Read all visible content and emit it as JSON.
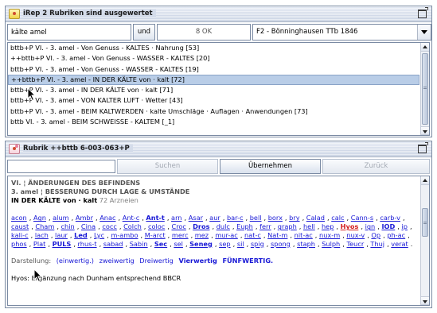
{
  "frame1": {
    "title": "iRep 2 Rubriken sind ausgewertet",
    "search": {
      "value": "kälte amel"
    },
    "und_label": "und",
    "ok_label": "8 OK",
    "source_select": "F2 - Bönninghausen  TTb 1846",
    "rubrics": [
      "bttb+P  VI. - 3. amel - Von Genuss - KALTES · Nahrung  [53]",
      "++bttb+P  VI. - 3. amel - Von Genuss - WASSER - KALTES [20]",
      "bttb+P  VI. - 3. amel - Von Genuss - WASSER - KALTES  [19]",
      "++bttb+P  VI. - 3. amel - IN DER KÄLTE von · kalt [72]",
      "bttb+P  VI. - 3. amel - IN DER KÄLTE von · kalt [71]",
      "bttb+P  VI. - 3. amel - VON KALTER LUFT · Wetter  [43]",
      "bttb+P  VI. - 3. amel - BEIM KALTWERDEN · kalte Umschläge · Auflagen · Anwendungen  [73]",
      "bttb  VI. - 3. amel - BEIM SCHWEISSE - KALTEM  [_1]"
    ],
    "selected_index": 3
  },
  "frame2": {
    "title": "Rubrik  ++bttb 6-003-063+P",
    "search_button": "Suchen",
    "accept_button": "Übernehmen",
    "back_button": "Zurück",
    "header_line1": "VI. ¦ ÄNDERUNGEN DES BEFINDENS",
    "header_line2": "3. amel ¦ BESSERUNG DURCH LAGE & UMSTÄNDE",
    "header_line3": "IN DER KÄLTE von · kalt",
    "remedy_count": "72 Arzneien",
    "remedies": [
      {
        "t": "acon",
        "s": ""
      },
      {
        "t": "Agn",
        "s": ""
      },
      {
        "t": "alum",
        "s": ""
      },
      {
        "t": "Ambr",
        "s": ""
      },
      {
        "t": "Anac",
        "s": ""
      },
      {
        "t": "Ant-c",
        "s": ""
      },
      {
        "t": "Ant-t",
        "s": "b"
      },
      {
        "t": "arn",
        "s": ""
      },
      {
        "t": "Asar",
        "s": ""
      },
      {
        "t": "aur",
        "s": ""
      },
      {
        "t": "bar-c",
        "s": ""
      },
      {
        "t": "bell",
        "s": ""
      },
      {
        "t": "borx",
        "s": ""
      },
      {
        "t": "bry",
        "s": ""
      },
      {
        "t": "Calad",
        "s": ""
      },
      {
        "t": "calc",
        "s": ""
      },
      {
        "t": "Cann-s",
        "s": ""
      },
      {
        "t": "carb-v",
        "s": ""
      },
      {
        "t": "caust",
        "s": ""
      },
      {
        "t": "Cham",
        "s": ""
      },
      {
        "t": "chin",
        "s": ""
      },
      {
        "t": "Cina",
        "s": ""
      },
      {
        "t": "cocc",
        "s": ""
      },
      {
        "t": "Colch",
        "s": ""
      },
      {
        "t": "coloc",
        "s": ""
      },
      {
        "t": "Croc",
        "s": ""
      },
      {
        "t": "Dros",
        "s": "b"
      },
      {
        "t": "dulc",
        "s": ""
      },
      {
        "t": "Euph",
        "s": ""
      },
      {
        "t": "ferr",
        "s": ""
      },
      {
        "t": "graph",
        "s": ""
      },
      {
        "t": "hell",
        "s": ""
      },
      {
        "t": "hep",
        "s": ""
      },
      {
        "t": "Hyos",
        "s": "red"
      },
      {
        "t": "ign",
        "s": ""
      },
      {
        "t": "IOD",
        "s": "b"
      },
      {
        "t": "ip",
        "s": ""
      },
      {
        "t": "kali-c",
        "s": ""
      },
      {
        "t": "lach",
        "s": ""
      },
      {
        "t": "laur",
        "s": ""
      },
      {
        "t": "Led",
        "s": "b"
      },
      {
        "t": "Lyc",
        "s": ""
      },
      {
        "t": "m-ambo",
        "s": ""
      },
      {
        "t": "M-arct",
        "s": ""
      },
      {
        "t": "merc",
        "s": ""
      },
      {
        "t": "mez",
        "s": ""
      },
      {
        "t": "mur-ac",
        "s": ""
      },
      {
        "t": "nat-c",
        "s": ""
      },
      {
        "t": "Nat-m",
        "s": ""
      },
      {
        "t": "nit-ac",
        "s": ""
      },
      {
        "t": "nux-m",
        "s": ""
      },
      {
        "t": "nux-v",
        "s": ""
      },
      {
        "t": "Op",
        "s": ""
      },
      {
        "t": "ph-ac",
        "s": ""
      },
      {
        "t": "phos",
        "s": ""
      },
      {
        "t": "Plat",
        "s": ""
      },
      {
        "t": "PULS",
        "s": "b"
      },
      {
        "t": "rhus-t",
        "s": ""
      },
      {
        "t": "sabad",
        "s": ""
      },
      {
        "t": "Sabin",
        "s": ""
      },
      {
        "t": "Sec",
        "s": "b"
      },
      {
        "t": "sel",
        "s": ""
      },
      {
        "t": "Seneg",
        "s": "b"
      },
      {
        "t": "sep",
        "s": ""
      },
      {
        "t": "sil",
        "s": ""
      },
      {
        "t": "spig",
        "s": ""
      },
      {
        "t": "spong",
        "s": ""
      },
      {
        "t": "staph",
        "s": ""
      },
      {
        "t": "Sulph",
        "s": ""
      },
      {
        "t": "Teucr",
        "s": ""
      },
      {
        "t": "Thuj",
        "s": ""
      },
      {
        "t": "verat",
        "s": ""
      }
    ],
    "legend_label": "Darstellung:",
    "legend_items": [
      "(einwertig.)",
      "zweiwertig",
      "Dreiwertig",
      "Vierwertig",
      "FÜNFWERTIG."
    ],
    "note": "Hyos: Ergänzung nach Dunham entsprechend BBCR"
  }
}
